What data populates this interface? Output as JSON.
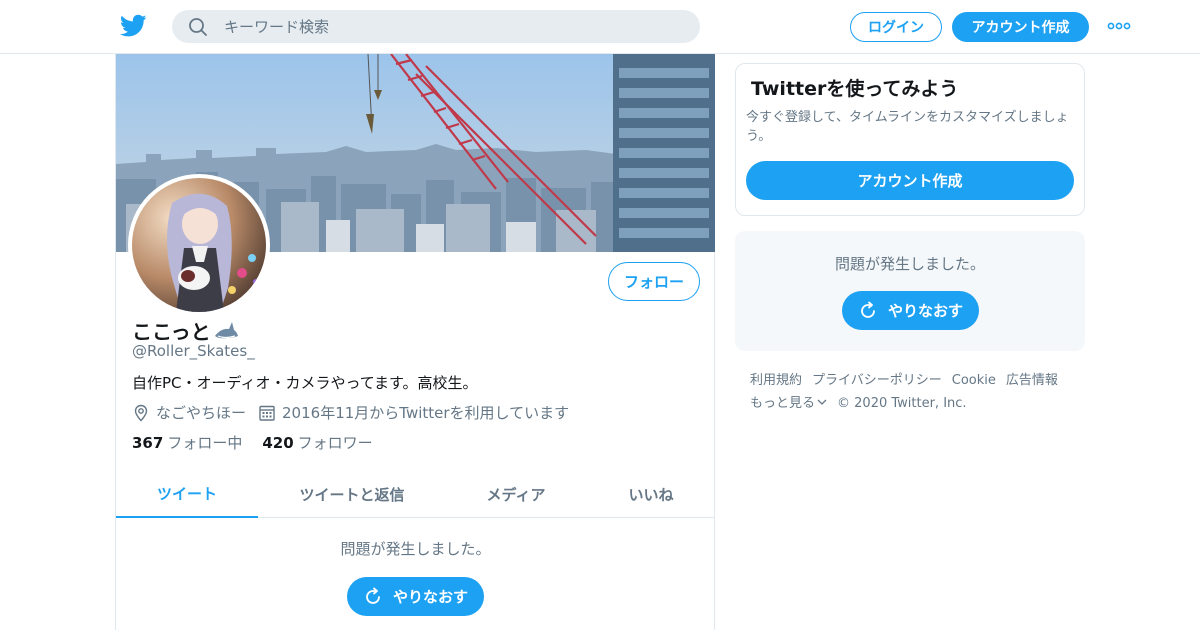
{
  "header": {
    "search_placeholder": "キーワード検索",
    "login_label": "ログイン",
    "signup_label": "アカウント作成"
  },
  "profile": {
    "name": "ここっと",
    "handle": "@Roller_Skates_",
    "bio": "自作PC・オーディオ・カメラやってます。高校生。",
    "location": "なごやちほー",
    "joined": "2016年11月からTwitterを利用しています",
    "following_count": "367",
    "following_label": "フォロー中",
    "followers_count": "420",
    "followers_label": "フォロワー",
    "follow_label": "フォロー"
  },
  "tabs": [
    {
      "label": "ツイート"
    },
    {
      "label": "ツイートと返信"
    },
    {
      "label": "メディア"
    },
    {
      "label": "いいね"
    }
  ],
  "timeline": {
    "error_message": "問題が発生しました。",
    "retry_label": "やりなおす"
  },
  "sidebar": {
    "signup_title": "Twitterを使ってみよう",
    "signup_desc": "今すぐ登録して、タイムラインをカスタマイズしましょう。",
    "signup_cta": "アカウント作成",
    "error_message": "問題が発生しました。",
    "retry_label": "やりなおす"
  },
  "footer": {
    "links": [
      "利用規約",
      "プライバシーポリシー",
      "Cookie",
      "広告情報"
    ],
    "more_label": "もっと見る",
    "copyright": "© 2020 Twitter, Inc."
  },
  "colors": {
    "accent": "#1da1f2",
    "text": "#14171a",
    "secondary": "#657786",
    "border": "#e1e8ed"
  }
}
